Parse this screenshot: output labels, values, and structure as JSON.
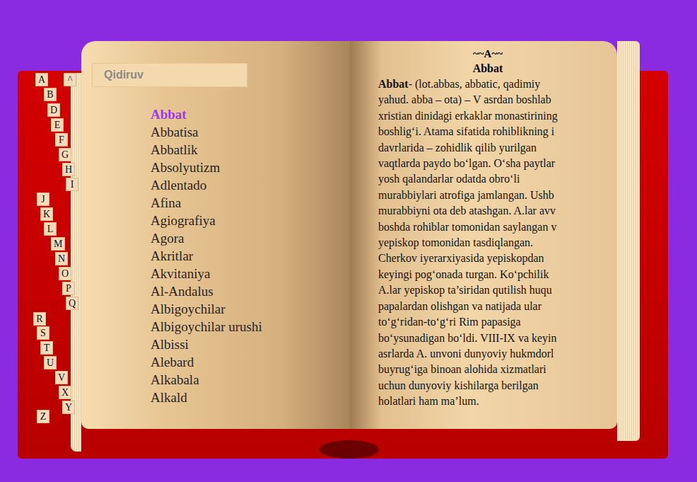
{
  "index_tabs": [
    {
      "label": "A"
    },
    {
      "label": "^"
    },
    {
      "label": "B"
    },
    {
      "label": "D"
    },
    {
      "label": "E"
    },
    {
      "label": "F"
    },
    {
      "label": "G"
    },
    {
      "label": "H"
    },
    {
      "label": "I"
    },
    {
      "label": "J"
    },
    {
      "label": "K"
    },
    {
      "label": "L"
    },
    {
      "label": "M"
    },
    {
      "label": "N"
    },
    {
      "label": "O"
    },
    {
      "label": "P"
    },
    {
      "label": "Q"
    },
    {
      "label": "R"
    },
    {
      "label": "S"
    },
    {
      "label": "T"
    },
    {
      "label": "U"
    },
    {
      "label": "V"
    },
    {
      "label": "X"
    },
    {
      "label": "Y"
    },
    {
      "label": "Z"
    }
  ],
  "search": {
    "placeholder": "Qidiruv"
  },
  "entries": [
    {
      "label": "Abbat",
      "selected": true
    },
    {
      "label": "Abbatisa",
      "selected": false
    },
    {
      "label": "Abbatlik",
      "selected": false
    },
    {
      "label": "Absolyutizm",
      "selected": false
    },
    {
      "label": "Adlentado",
      "selected": false
    },
    {
      "label": "Afina",
      "selected": false
    },
    {
      "label": "Agiografiya",
      "selected": false
    },
    {
      "label": "Agora",
      "selected": false
    },
    {
      "label": "Akritlar",
      "selected": false
    },
    {
      "label": "Akvitaniya",
      "selected": false
    },
    {
      "label": "Al-Andalus",
      "selected": false
    },
    {
      "label": "Albigoychilar",
      "selected": false
    },
    {
      "label": "Albigoychilar urushi",
      "selected": false
    },
    {
      "label": "Albissi",
      "selected": false
    },
    {
      "label": "Alebard",
      "selected": false
    },
    {
      "label": "Alkabala",
      "selected": false
    },
    {
      "label": "Alkald",
      "selected": false
    }
  ],
  "article": {
    "letter_heading": "~~A~~",
    "title": "Abbat",
    "term": "Abbat",
    "first_line_rest": "- (lot.abbas, abbatic, qadimiy",
    "lines": [
      "yahud. abba – ota) – V asrdan boshlab",
      "xristian dinidagi erkaklar monastirining",
      "boshlig‘i. Atama sifatida rohiblikning i",
      "davrlarida – zohidlik qilib yurilgan",
      "vaqtlarda paydo bo‘lgan. O‘sha paytlar",
      "yosh qalandarlar odatda obro‘li",
      "murabbiylari atrofiga jamlangan. Ushb",
      "murabbiyni ota deb atashgan. A.lar avv",
      "boshda rohiblar tomonidan saylangan v",
      "yepiskop tomonidan tasdiqlangan.",
      "Cherkov iyerarxiyasida yepiskopdan",
      "keyingi pog‘onada turgan. Ko‘pchilik",
      "A.lar yepiskop ta’siridan qutilish huqu",
      "papalardan olishgan va natijada ular",
      "to‘g‘ridan-to‘g‘ri Rim papasiga",
      "bo‘ysunadigan bo‘ldi. VIII-IX va keyin",
      "asrlarda A. unvoni dunyoviy hukmdorl",
      "buyrug‘iga binoan alohida xizmatlari",
      "uchun dunyoviy kishilarga berilgan",
      "holatlari ham ma’lum."
    ]
  }
}
